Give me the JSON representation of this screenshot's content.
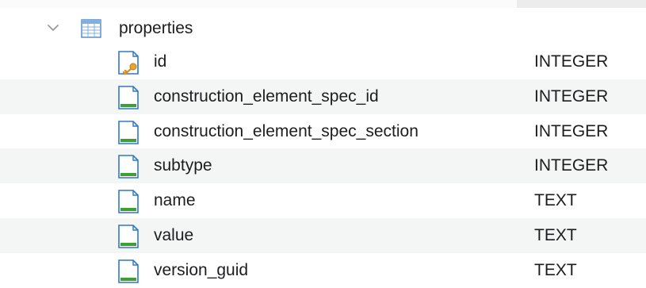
{
  "table": {
    "name": "properties",
    "expanded": true,
    "icon": "table-icon",
    "columns": [
      {
        "name": "id",
        "type": "INTEGER",
        "icon": "primary-key-column-icon"
      },
      {
        "name": "construction_element_spec_id",
        "type": "INTEGER",
        "icon": "column-icon"
      },
      {
        "name": "construction_element_spec_section",
        "type": "INTEGER",
        "icon": "column-icon"
      },
      {
        "name": "subtype",
        "type": "INTEGER",
        "icon": "column-icon"
      },
      {
        "name": "name",
        "type": "TEXT",
        "icon": "column-icon"
      },
      {
        "name": "value",
        "type": "TEXT",
        "icon": "column-icon"
      },
      {
        "name": "version_guid",
        "type": "TEXT",
        "icon": "column-icon"
      }
    ]
  },
  "colors": {
    "row_stripe": "#f4f5f5",
    "icon_blue": "#2f78c8",
    "icon_green": "#3ea033",
    "key_gold": "#e7a532"
  }
}
